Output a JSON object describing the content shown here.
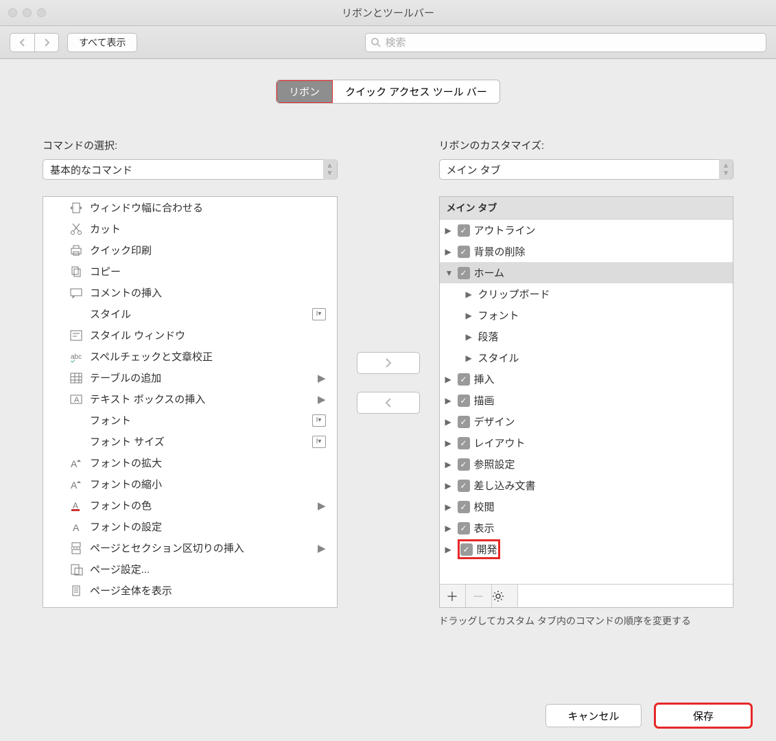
{
  "window": {
    "title": "リボンとツールバー"
  },
  "toolbar": {
    "show_all": "すべて表示",
    "search_placeholder": "検索"
  },
  "tabs": {
    "ribbon": "リボン",
    "qat": "クイック アクセス ツール バー"
  },
  "left": {
    "label": "コマンドの選択:",
    "select_value": "基本的なコマンド",
    "items": [
      {
        "label": "ウィンドウ幅に合わせる",
        "icon": "fit-width"
      },
      {
        "label": "カット",
        "icon": "cut"
      },
      {
        "label": "クイック印刷",
        "icon": "print"
      },
      {
        "label": "コピー",
        "icon": "copy"
      },
      {
        "label": "コメントの挿入",
        "icon": "comment"
      },
      {
        "label": "スタイル",
        "icon": "",
        "mod": true
      },
      {
        "label": "スタイル ウィンドウ",
        "icon": "style-pane"
      },
      {
        "label": "スペルチェックと文章校正",
        "icon": "spell"
      },
      {
        "label": "テーブルの追加",
        "icon": "table",
        "sub": true
      },
      {
        "label": "テキスト ボックスの挿入",
        "icon": "textbox",
        "sub": true
      },
      {
        "label": "フォント",
        "icon": "",
        "mod": true
      },
      {
        "label": "フォント サイズ",
        "icon": "",
        "mod": true
      },
      {
        "label": "フォントの拡大",
        "icon": "font-grow"
      },
      {
        "label": "フォントの縮小",
        "icon": "font-shrink"
      },
      {
        "label": "フォントの色",
        "icon": "font-color",
        "sub": true
      },
      {
        "label": "フォントの設定",
        "icon": "font-settings"
      },
      {
        "label": "ページとセクション区切りの挿入",
        "icon": "page-break",
        "sub": true
      },
      {
        "label": "ページ設定...",
        "icon": "page-setup"
      },
      {
        "label": "ページ全体を表示",
        "icon": "page-full"
      }
    ]
  },
  "right": {
    "label": "リボンのカスタマイズ:",
    "select_value": "メイン タブ",
    "header": "メイン タブ",
    "tree": [
      {
        "label": "アウトライン",
        "d": 1,
        "chk": true,
        "disc": "▶"
      },
      {
        "label": "背景の削除",
        "d": 1,
        "chk": true,
        "disc": "▶"
      },
      {
        "label": "ホーム",
        "d": 1,
        "chk": true,
        "disc": "▼",
        "sel": true
      },
      {
        "label": "クリップボード",
        "d": 2,
        "disc": "▶"
      },
      {
        "label": "フォント",
        "d": 2,
        "disc": "▶"
      },
      {
        "label": "段落",
        "d": 2,
        "disc": "▶"
      },
      {
        "label": "スタイル",
        "d": 2,
        "disc": "▶"
      },
      {
        "label": "挿入",
        "d": 1,
        "chk": true,
        "disc": "▶"
      },
      {
        "label": "描画",
        "d": 1,
        "chk": true,
        "disc": "▶"
      },
      {
        "label": "デザイン",
        "d": 1,
        "chk": true,
        "disc": "▶"
      },
      {
        "label": "レイアウト",
        "d": 1,
        "chk": true,
        "disc": "▶"
      },
      {
        "label": "参照設定",
        "d": 1,
        "chk": true,
        "disc": "▶"
      },
      {
        "label": "差し込み文書",
        "d": 1,
        "chk": true,
        "disc": "▶"
      },
      {
        "label": "校閲",
        "d": 1,
        "chk": true,
        "disc": "▶"
      },
      {
        "label": "表示",
        "d": 1,
        "chk": true,
        "disc": "▶"
      },
      {
        "label": "開発",
        "d": 1,
        "chk": true,
        "disc": "▶",
        "hl": true
      }
    ],
    "hint": "ドラッグしてカスタム タブ内のコマンドの順序を変更する"
  },
  "footer": {
    "cancel": "キャンセル",
    "save": "保存"
  }
}
